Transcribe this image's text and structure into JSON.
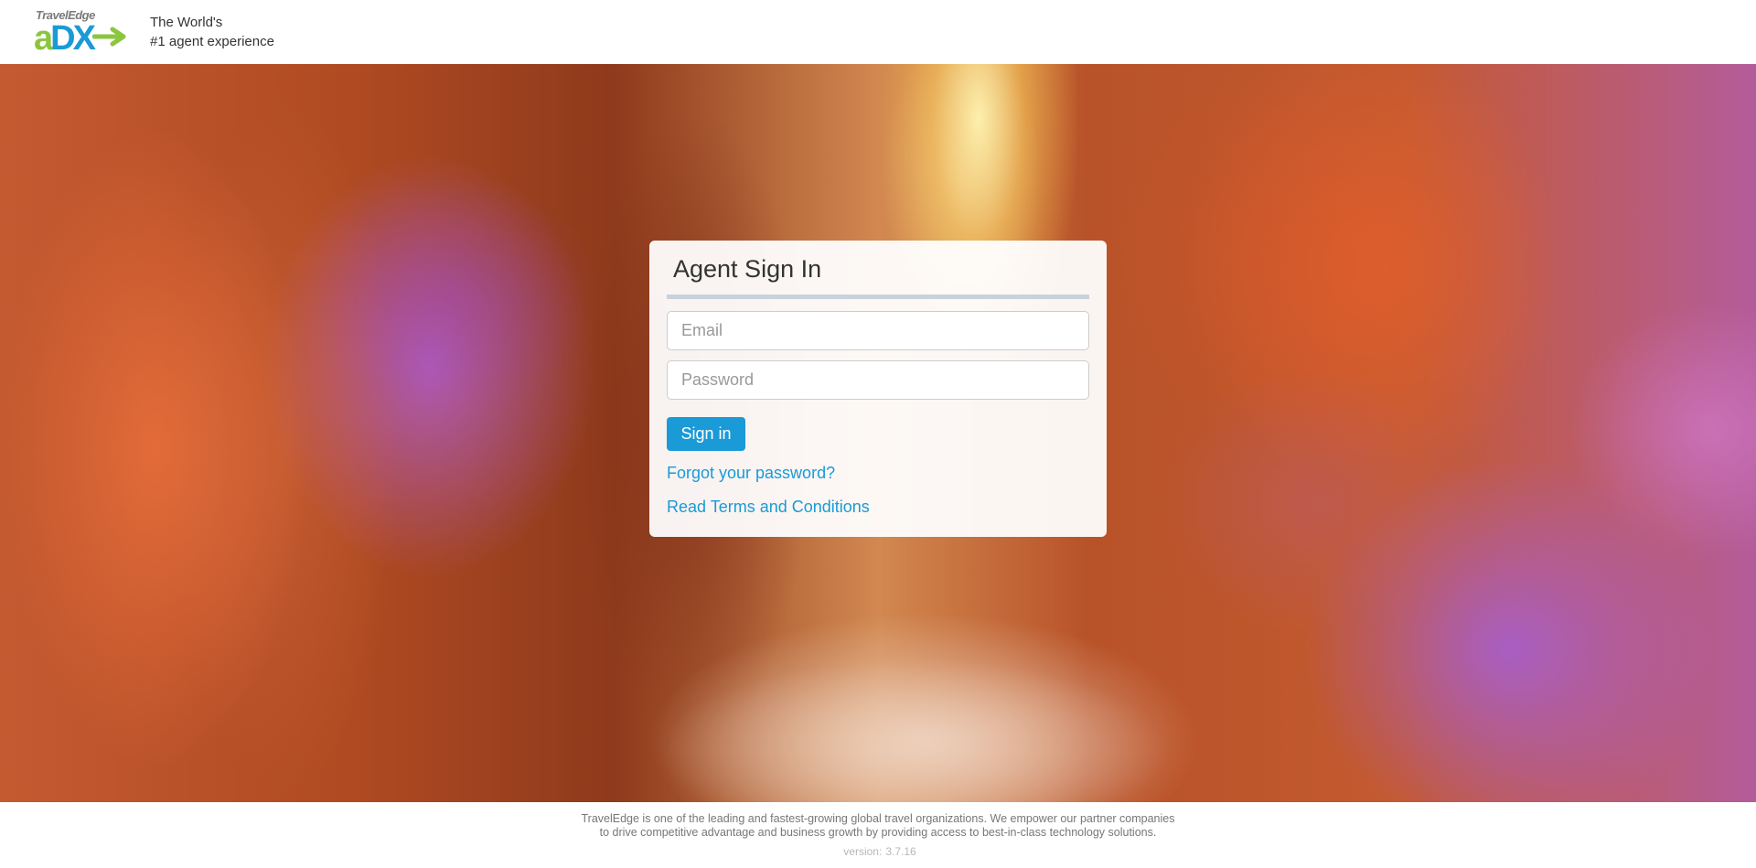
{
  "header": {
    "logo_brand": "TravelEdge",
    "logo_letters_a": "a",
    "logo_letters_dx": "DX",
    "tagline_line1": "The World's",
    "tagline_line2": "#1 agent experience"
  },
  "signin": {
    "title": "Agent Sign In",
    "email_placeholder": "Email",
    "password_placeholder": "Password",
    "button_label": "Sign in",
    "forgot_link": "Forgot your password?",
    "terms_link": "Read Terms and Conditions"
  },
  "footer": {
    "line1": "TravelEdge is one of the leading and fastest-growing global travel organizations. We empower our partner companies",
    "line2": "to drive competitive advantage and business growth by providing access to best-in-class technology solutions.",
    "version_label": "version:",
    "version_value": "3.7.16"
  },
  "colors": {
    "accent_blue": "#1a9ad6",
    "logo_green": "#8cc63f",
    "card_rule": "#c9d2da"
  },
  "icons": {
    "logo_arrow": "arrow-right-icon"
  }
}
